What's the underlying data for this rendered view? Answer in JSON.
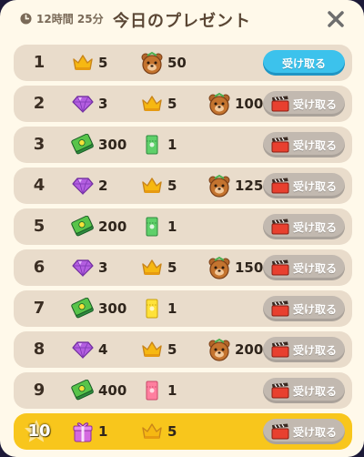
{
  "header": {
    "timer_text": "12時間 25分",
    "title": "今日のプレゼント",
    "close_icon": "close-x-icon"
  },
  "button_label": "受け取る",
  "colors": {
    "row_bg": "#e9dccb",
    "row_highlight_bg": "#f8c61c",
    "button_active": "#3cc2ec",
    "button_disabled": "#c2b9b0",
    "title_color": "#5a4634"
  },
  "rows": [
    {
      "num": "1",
      "items": [
        {
          "icon": "crown",
          "amount": "5"
        },
        {
          "icon": "bear-head",
          "amount": "50"
        }
      ],
      "button": "active"
    },
    {
      "num": "2",
      "items": [
        {
          "icon": "purple-gem",
          "amount": "3"
        },
        {
          "icon": "crown",
          "amount": "5"
        },
        {
          "icon": "bear-head",
          "amount": "100"
        }
      ],
      "button": "video"
    },
    {
      "num": "3",
      "items": [
        {
          "icon": "cash",
          "amount": "300"
        },
        {
          "icon": "green-ticket",
          "amount": "1"
        }
      ],
      "button": "video"
    },
    {
      "num": "4",
      "items": [
        {
          "icon": "purple-gem",
          "amount": "2"
        },
        {
          "icon": "crown",
          "amount": "5"
        },
        {
          "icon": "bear-head",
          "amount": "125"
        }
      ],
      "button": "video"
    },
    {
      "num": "5",
      "items": [
        {
          "icon": "cash",
          "amount": "200"
        },
        {
          "icon": "green-ticket",
          "amount": "1"
        }
      ],
      "button": "video"
    },
    {
      "num": "6",
      "items": [
        {
          "icon": "purple-gem",
          "amount": "3"
        },
        {
          "icon": "crown",
          "amount": "5"
        },
        {
          "icon": "bear-head",
          "amount": "150"
        }
      ],
      "button": "video"
    },
    {
      "num": "7",
      "items": [
        {
          "icon": "cash",
          "amount": "300"
        },
        {
          "icon": "yellow-ticket",
          "amount": "1"
        }
      ],
      "button": "video"
    },
    {
      "num": "8",
      "items": [
        {
          "icon": "purple-gem",
          "amount": "4"
        },
        {
          "icon": "crown",
          "amount": "5"
        },
        {
          "icon": "bear-head",
          "amount": "200"
        }
      ],
      "button": "video"
    },
    {
      "num": "9",
      "items": [
        {
          "icon": "cash",
          "amount": "400"
        },
        {
          "icon": "pink-ticket",
          "amount": "1"
        }
      ],
      "button": "video"
    },
    {
      "num": "10",
      "items": [
        {
          "icon": "gift-box",
          "amount": "1"
        },
        {
          "icon": "crown",
          "amount": "5"
        }
      ],
      "button": "video",
      "highlight": true
    }
  ]
}
